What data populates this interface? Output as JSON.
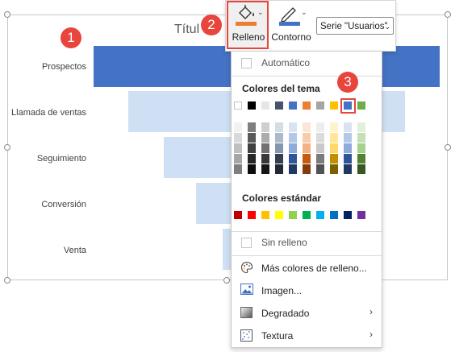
{
  "chart": {
    "title": "Títul",
    "categories": [
      "Prospectos",
      "Llamada de ventas",
      "Seguimiento",
      "Conversión",
      "Venta"
    ]
  },
  "callouts": [
    "1",
    "2",
    "3"
  ],
  "toolbar": {
    "fill_label": "Relleno",
    "outline_label": "Contorno",
    "series_select_value": "Serie \"Usuarios\""
  },
  "menu": {
    "automatic": "Automático",
    "theme_colors_title": "Colores del tema",
    "standard_colors_title": "Colores estándar",
    "no_fill": "Sin relleno",
    "more_colors": "Más colores de relleno...",
    "picture": "Imagen...",
    "gradient": "Degradado",
    "texture": "Textura"
  },
  "colors": {
    "theme_top": [
      "#ffffff",
      "#000000",
      "#e7e6e6",
      "#44546a",
      "#4472c4",
      "#ed7d31",
      "#a5a5a5",
      "#ffc000",
      "#4472c4",
      "#70ad47"
    ],
    "standard": [
      "#c00000",
      "#ff0000",
      "#ffc000",
      "#ffff00",
      "#92d050",
      "#00b050",
      "#00b0f0",
      "#0070c0",
      "#002060",
      "#7030a0"
    ],
    "selected_accent": "#4472c4",
    "callout_red": "#e8453c",
    "fill_bucket_orange": "#ed7d31"
  }
}
